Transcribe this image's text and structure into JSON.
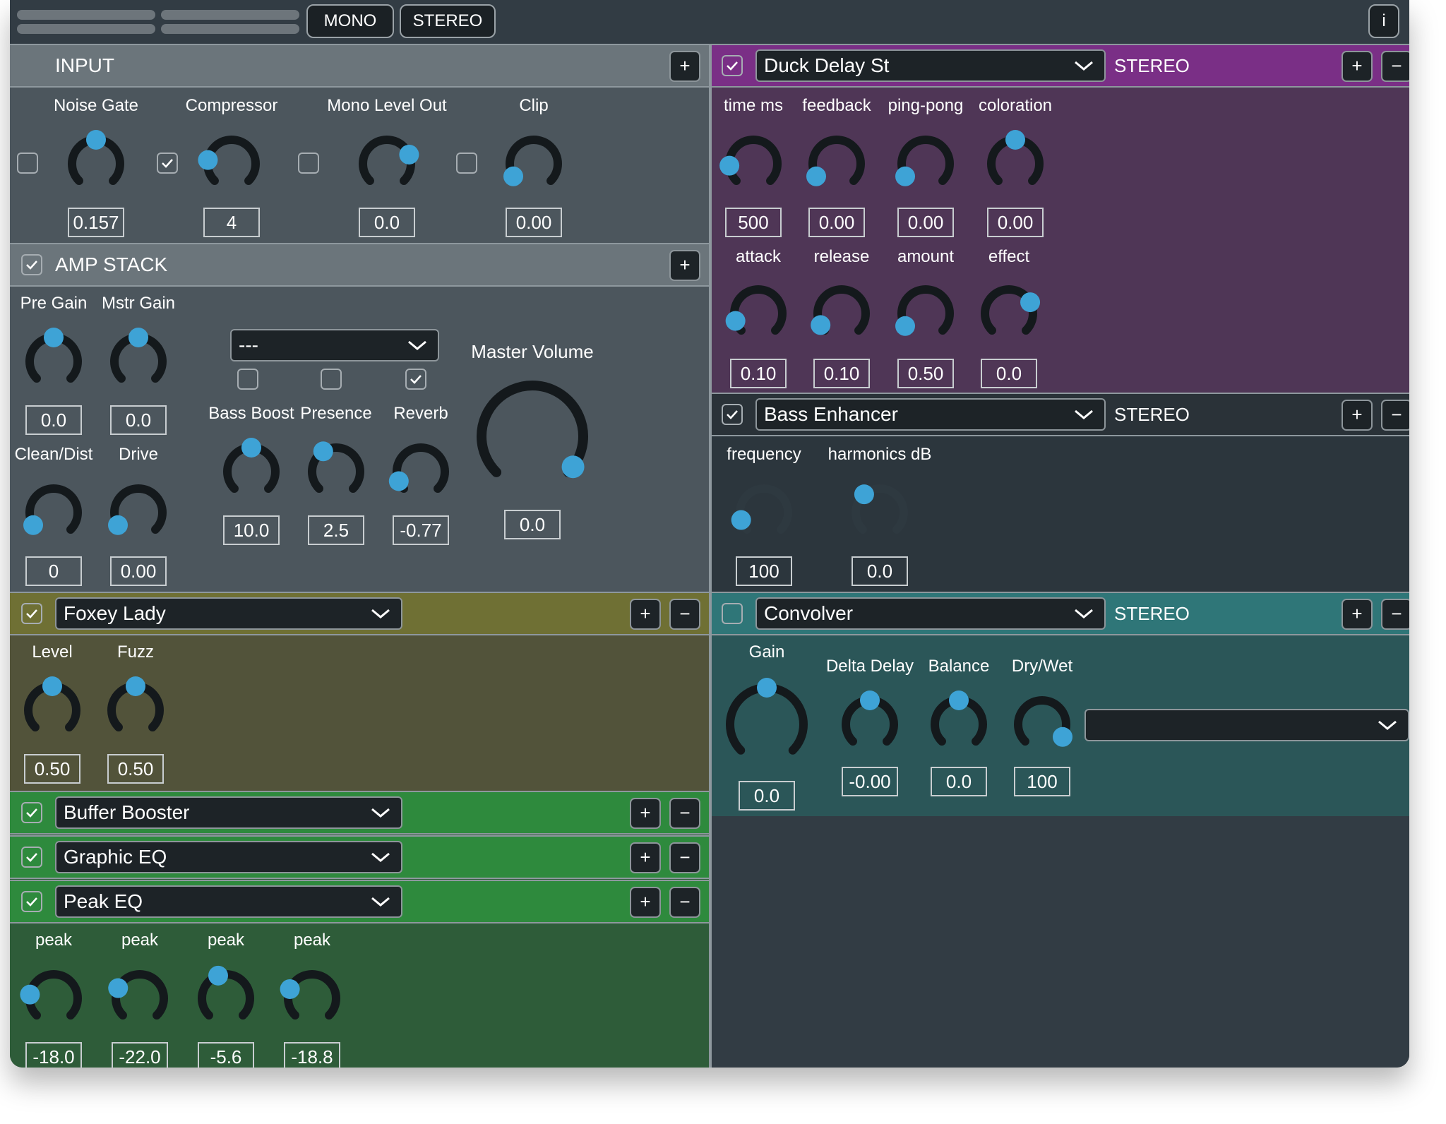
{
  "topbar": {
    "mono_label": "MONO",
    "stereo_label": "STEREO",
    "info_label": "i"
  },
  "icons": {
    "add": "plus-icon",
    "remove": "minus-icon",
    "dropdown": "chevron-down-icon",
    "check": "checkmark-icon"
  },
  "colors": {
    "knob_track": "#14191c",
    "knob_dot": "#3ea3d6",
    "input_bg": "#4c565d",
    "delay_bg": "#4f3656",
    "delay_hdr": "#7a2f86",
    "foxey_bg": "#52533a",
    "foxey_hdr": "#6f7034",
    "green_bg": "#2e5c39",
    "green_hdr": "#2e8a3d",
    "convolver_bg": "#2b5658",
    "convolver_hdr": "#2f7678"
  },
  "input": {
    "title": "INPUT",
    "add": "+",
    "knobs": [
      {
        "label": "Noise Gate",
        "value": "0.157",
        "enabled": false,
        "level": 0.5
      },
      {
        "label": "Compressor",
        "value": "4",
        "enabled": true,
        "level": 0.2
      },
      {
        "label": "Mono Level Out",
        "value": "0.0",
        "enabled": false,
        "level": 0.75
      },
      {
        "label": "Clip",
        "value": "0.00",
        "enabled": false,
        "level": 0.05
      }
    ]
  },
  "amp": {
    "title": "AMP STACK",
    "enabled": true,
    "add": "+",
    "model_select": "---",
    "knobs": [
      {
        "label": "Pre Gain",
        "value": "0.0",
        "level": 0.5
      },
      {
        "label": "Mstr Gain",
        "value": "0.0",
        "level": 0.5
      },
      {
        "label": "Clean/Dist",
        "value": "0",
        "level": 0.05
      },
      {
        "label": "Drive",
        "value": "0.00",
        "level": 0.05
      }
    ],
    "tone": [
      {
        "label": "Bass Boost",
        "value": "10.0",
        "enabled": false,
        "level": 0.5
      },
      {
        "label": "Presence",
        "value": "2.5",
        "enabled": false,
        "level": 0.38
      },
      {
        "label": "Reverb",
        "value": "-0.77",
        "enabled": true,
        "level": 0.08
      }
    ],
    "master": {
      "label": "Master Volume",
      "value": "0.0",
      "level": 0.97
    }
  },
  "left_modules": [
    {
      "name": "Foxey Lady",
      "enabled": true,
      "add": "+",
      "remove": "−"
    },
    {
      "name": "Buffer Booster",
      "enabled": true,
      "add": "+",
      "remove": "−"
    },
    {
      "name": "Graphic EQ",
      "enabled": true,
      "add": "+",
      "remove": "−"
    },
    {
      "name": "Peak EQ",
      "enabled": true,
      "add": "+",
      "remove": "−"
    }
  ],
  "foxey": {
    "knobs": [
      {
        "label": "Level",
        "value": "0.50",
        "level": 0.5
      },
      {
        "label": "Fuzz",
        "value": "0.50",
        "level": 0.5
      }
    ]
  },
  "peak": {
    "knobs": [
      {
        "label": "peak",
        "value": "-18.0",
        "level": 0.2
      },
      {
        "label": "peak",
        "value": "-22.0",
        "level": 0.26
      },
      {
        "label": "peak",
        "value": "-5.6",
        "level": 0.43
      },
      {
        "label": "peak",
        "value": "-18.8",
        "level": 0.25
      }
    ]
  },
  "right_modules": [
    {
      "name": "Duck Delay St",
      "enabled": true,
      "mode": "STEREO",
      "add": "+",
      "remove": "−"
    },
    {
      "name": "Bass Enhancer",
      "enabled": true,
      "mode": "STEREO",
      "add": "+",
      "remove": "−"
    },
    {
      "name": "Convolver",
      "enabled": false,
      "mode": "STEREO",
      "add": "+",
      "remove": "−"
    }
  ],
  "delay": {
    "row1": [
      {
        "label": "time ms",
        "value": "500",
        "level": 0.15
      },
      {
        "label": "feedback",
        "value": "0.00",
        "level": 0.05
      },
      {
        "label": "ping-pong",
        "value": "0.00",
        "level": 0.05
      },
      {
        "label": "coloration",
        "value": "0.00",
        "level": 0.5
      }
    ],
    "row2": [
      {
        "label": "attack",
        "value": "0.10",
        "level": 0.1
      },
      {
        "label": "release",
        "value": "0.10",
        "level": 0.06
      },
      {
        "label": "amount",
        "value": "0.50",
        "level": 0.05
      },
      {
        "label": "effect",
        "value": "0.0",
        "level": 0.73
      }
    ]
  },
  "enhancer": {
    "knobs": [
      {
        "label": "frequency",
        "value": "100",
        "level": 0.1
      },
      {
        "label": "harmonics dB",
        "value": "0.0",
        "level": 0.35
      }
    ]
  },
  "convolver": {
    "knobs": [
      {
        "label": "Gain",
        "value": "0.0",
        "level": 0.5
      },
      {
        "label": "Delta Delay",
        "value": "-0.00",
        "level": 0.5
      },
      {
        "label": "Balance",
        "value": "0.0",
        "level": 0.5
      },
      {
        "label": "Dry/Wet",
        "value": "100",
        "level": 0.95
      }
    ],
    "impulse_select": ""
  }
}
